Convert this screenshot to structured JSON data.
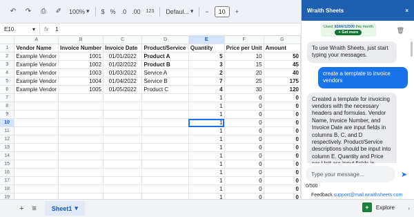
{
  "toolbar": {
    "undo_icon": "undo-icon",
    "redo_icon": "redo-icon",
    "zoom": "100%",
    "currency": "$",
    "percent": "%",
    "dec_less": ".0",
    "dec_more": ".00",
    "number_format": "123",
    "font": "Defaul...",
    "font_size": "10",
    "minus": "−",
    "plus": "+"
  },
  "formula": {
    "cell_ref": "E10",
    "fx": "fx",
    "value": "1"
  },
  "grid": {
    "columns": [
      "A",
      "B",
      "C",
      "D",
      "E",
      "F",
      "G"
    ],
    "row_numbers": [
      "1",
      "2",
      "3",
      "4",
      "5",
      "6",
      "7",
      "8",
      "9",
      "10",
      "11",
      "12",
      "13",
      "14",
      "15",
      "16",
      "17",
      "18",
      "19"
    ],
    "header": [
      "Vendor Name",
      "Invoice Number",
      "Invoice Date",
      "Product/Service",
      "Quantity",
      "Price per Unit",
      "Amount"
    ],
    "data_rows": [
      [
        "Example Vendor",
        "1001",
        "01/01/2022",
        "Product A",
        "5",
        "10",
        "50"
      ],
      [
        "Example Vendor",
        "1002",
        "01/02/2022",
        "Product B",
        "3",
        "15",
        "45"
      ],
      [
        "Example Vendor",
        "1003",
        "01/03/2022",
        "Service A",
        "2",
        "20",
        "40"
      ],
      [
        "Example Vendor",
        "1004",
        "01/04/2022",
        "Service B",
        "7",
        "25",
        "175"
      ],
      [
        "Example Vendor",
        "1005",
        "01/05/2022",
        "Product C",
        "4",
        "30",
        "120"
      ]
    ],
    "default_row": [
      "",
      "",
      "",
      "",
      "1",
      "0",
      "0"
    ]
  },
  "sheets": {
    "add_icon": "plus-icon",
    "list_icon": "list-icon",
    "active_tab": "Sheet1",
    "explore": "Explore"
  },
  "panel": {
    "title": "Wraith Sheets",
    "close": "×",
    "usage_prefix": "Used:",
    "usage_value": "8166/12500",
    "usage_suffix": "this month",
    "get_more": "+ Get more",
    "messages": [
      {
        "role": "bot",
        "text": "To use Wraith Sheets, just start typing your messages."
      },
      {
        "role": "user",
        "text": "create a template to invoice vendors"
      },
      {
        "role": "bot",
        "text": "Created a template for invoicing vendors with the necessary headers and formulas. Vendor Name, Invoice Number, and Invoice Date are input fields in columns B, C, and D respectively. Product/Service descriptions should be input into column E. Quantity and Price per Unit are input fields in columns F and G, with default values of 1 and 0. The Amount"
      }
    ],
    "placeholder": "Type your message...",
    "counter": "0/500",
    "feedback_label": "Feedback",
    "feedback_email": "support@mail.wraithsheets.com"
  }
}
